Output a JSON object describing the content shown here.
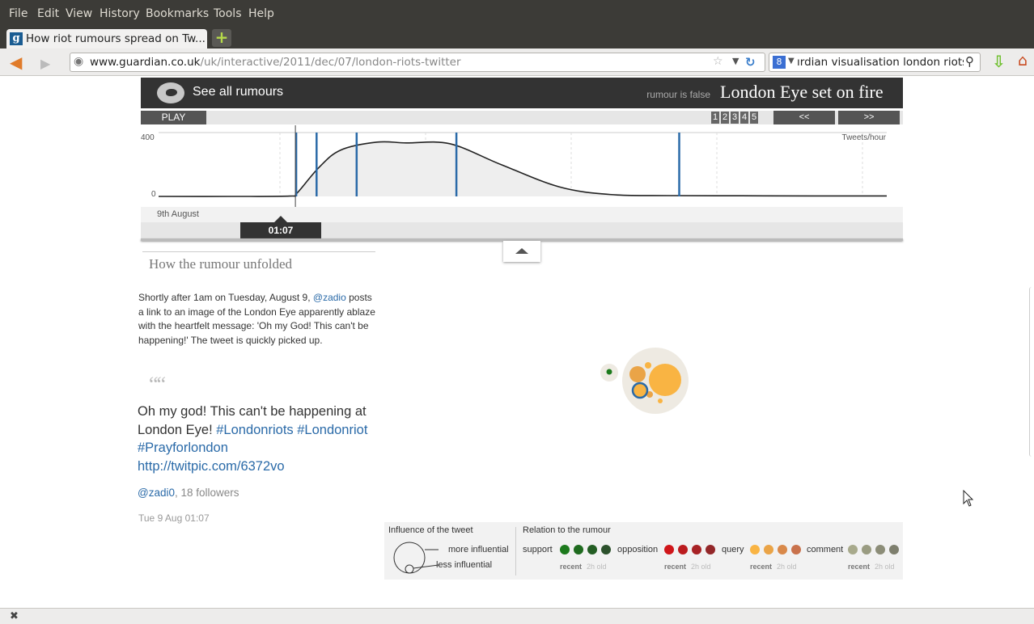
{
  "browser": {
    "menu": [
      "File",
      "Edit",
      "View",
      "History",
      "Bookmarks",
      "Tools",
      "Help"
    ],
    "menu_accel": [
      "F",
      "E",
      "V",
      "s",
      "B",
      "T",
      "H"
    ],
    "tab_title": "How riot rumours spread on Tw...",
    "url_domain": "www.guardian.co.uk",
    "url_path": "/uk/interactive/2011/dec/07/london-riots-twitter",
    "search_text": "ırdian visualisation london riots"
  },
  "header": {
    "see_all": "See all rumours",
    "status": "rumour is false",
    "title": "London Eye set on fire"
  },
  "controls": {
    "play": "PLAY",
    "pages": [
      "1",
      "2",
      "3",
      "4",
      "5"
    ],
    "prev": "<<",
    "next": ">>"
  },
  "chart_data": {
    "type": "area",
    "ylabel": "Tweets/hour",
    "ylim": [
      0,
      400
    ],
    "yticks": [
      "400",
      "0"
    ],
    "date_label": "9th August",
    "current_time": "01:07",
    "x": [
      0,
      0.1,
      0.18,
      0.19,
      0.22,
      0.25,
      0.3,
      0.34,
      0.4,
      0.47,
      0.55,
      0.62,
      0.7,
      0.8,
      0.9,
      1.0
    ],
    "values": [
      0,
      0,
      2,
      20,
      180,
      290,
      340,
      335,
      330,
      200,
      60,
      12,
      5,
      4,
      3,
      3
    ],
    "markers": [
      0.189,
      0.217,
      0.272,
      0.409,
      0.715
    ]
  },
  "story": {
    "heading": "How the rumour unfolded",
    "body_before": "Shortly after 1am on Tuesday, August 9, ",
    "body_link": "@zadio",
    "body_after": " posts a link to an image of the London Eye apparently ablaze with the heartfelt message: 'Oh my God! This can't be happening!' The tweet is quickly picked up.",
    "quote_mark": "66",
    "tweet_text": "Oh my god! This can't be happening at London Eye! ",
    "tweet_tags": "#Londonriots #Londonriot #Prayforlondon http://twitpic.com/6372vo",
    "user": "@zadi0",
    "followers": ", 18 followers",
    "date": "Tue 9 Aug 01:07"
  },
  "legend": {
    "influence_title": "Influence of the tweet",
    "more": "more influential",
    "less": "less influential",
    "relation_title": "Relation to the rumour",
    "categories": [
      {
        "label": "support",
        "colors": [
          "#1d7a1d",
          "#1f6b1f",
          "#245e24",
          "#2c512c"
        ]
      },
      {
        "label": "opposition",
        "colors": [
          "#d0161a",
          "#bb1c1f",
          "#a72225",
          "#932729"
        ]
      },
      {
        "label": "query",
        "colors": [
          "#f9b443",
          "#eaa447",
          "#d9894a",
          "#c9724c"
        ]
      },
      {
        "label": "comment",
        "colors": [
          "#a8aa8c",
          "#9a9c82",
          "#8c8d78",
          "#7e7f6e"
        ]
      }
    ],
    "recent": "recent",
    "old": "2h old"
  }
}
